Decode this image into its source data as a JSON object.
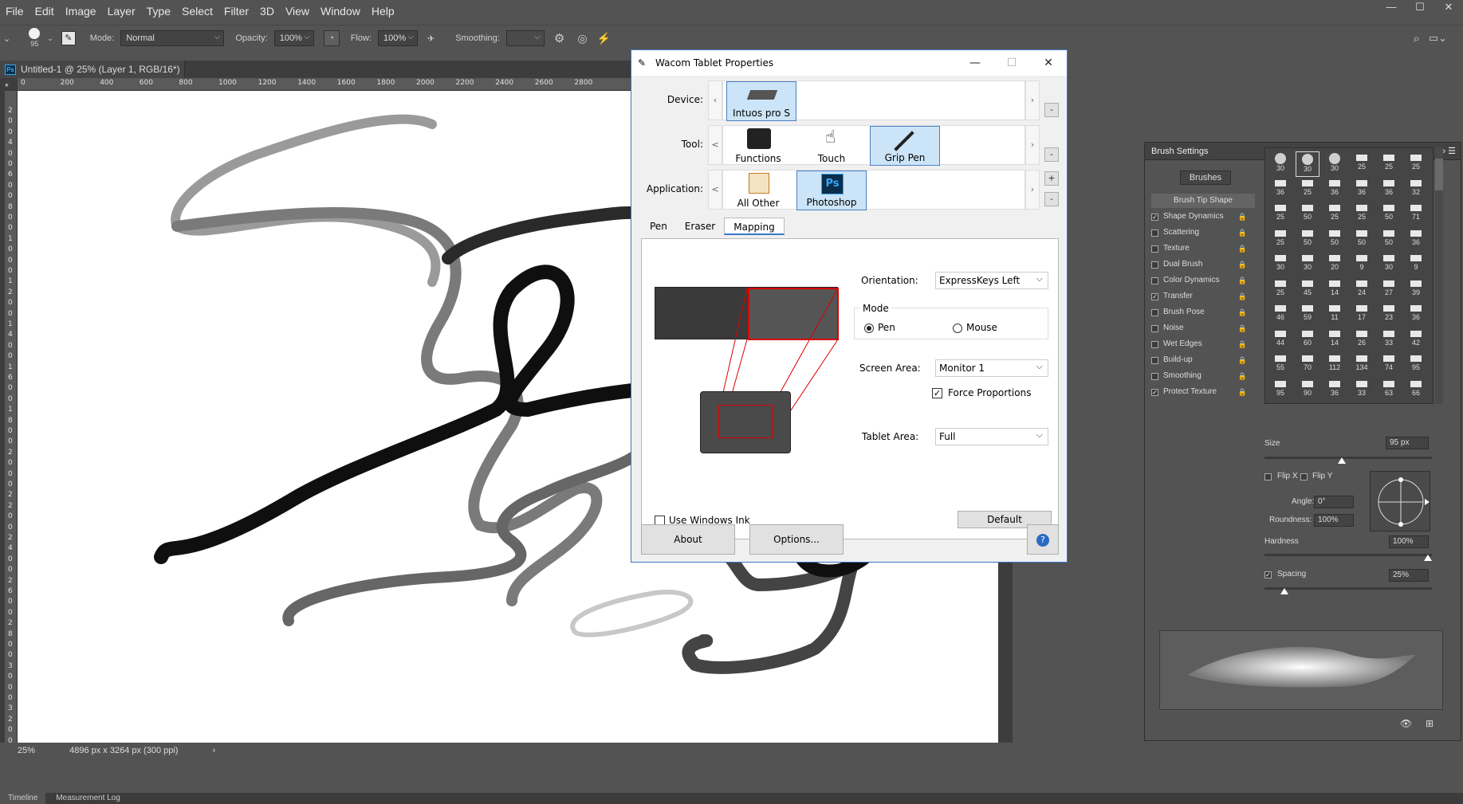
{
  "menu": [
    "File",
    "Edit",
    "Image",
    "Layer",
    "Type",
    "Select",
    "Filter",
    "3D",
    "View",
    "Window",
    "Help"
  ],
  "window_controls": [
    "—",
    "☐",
    "✕"
  ],
  "options_bar": {
    "brush_size": "95",
    "mode_label": "Mode:",
    "mode_value": "Normal",
    "opacity_label": "Opacity:",
    "opacity_value": "100%",
    "flow_label": "Flow:",
    "flow_value": "100%",
    "smoothing_label": "Smoothing:"
  },
  "document": {
    "tab_title": "Untitled-1 @ 25% (Layer 1, RGB/16*) *",
    "ruler_h": [
      "0",
      "200",
      "400",
      "600",
      "800",
      "1000",
      "1200",
      "1400",
      "1600",
      "1800",
      "2000",
      "2200",
      "2400",
      "2600",
      "2800"
    ],
    "ruler_v": [
      "2",
      "0",
      "0",
      "4",
      "0",
      "0",
      "6",
      "0",
      "0",
      "8",
      "0",
      "0",
      "1",
      "0",
      "0",
      "0",
      "1",
      "2",
      "0",
      "0",
      "1",
      "4",
      "0",
      "0",
      "1",
      "6",
      "0",
      "0",
      "1",
      "8",
      "0",
      "0",
      "2",
      "0",
      "0",
      "0",
      "2",
      "2",
      "0",
      "0",
      "2",
      "4",
      "0",
      "0",
      "2",
      "6",
      "0",
      "0",
      "2",
      "8",
      "0",
      "0",
      "3",
      "0",
      "0",
      "0",
      "3",
      "2",
      "0",
      "0"
    ],
    "zoom": "25%",
    "doc_size": "4896 px x 3264 px (300 ppi)"
  },
  "bottom_tabs": [
    "Timeline",
    "Measurement Log"
  ],
  "brush_settings": {
    "title": "Brush Settings",
    "brushes_button": "Brushes",
    "tip_shape": "Brush Tip Shape",
    "options": [
      {
        "label": "Shape Dynamics",
        "checked": true
      },
      {
        "label": "Scattering",
        "checked": false
      },
      {
        "label": "Texture",
        "checked": false
      },
      {
        "label": "Dual Brush",
        "checked": false
      },
      {
        "label": "Color Dynamics",
        "checked": false
      },
      {
        "label": "Transfer",
        "checked": true
      },
      {
        "label": "Brush Pose",
        "checked": false
      },
      {
        "label": "Noise",
        "checked": false
      },
      {
        "label": "Wet Edges",
        "checked": false
      },
      {
        "label": "Build-up",
        "checked": false
      },
      {
        "label": "Smoothing",
        "checked": false
      },
      {
        "label": "Protect Texture",
        "checked": true
      }
    ],
    "presets": [
      "30",
      "30",
      "30",
      "25",
      "25",
      "25",
      "36",
      "25",
      "36",
      "36",
      "36",
      "32",
      "25",
      "50",
      "25",
      "25",
      "50",
      "71",
      "25",
      "50",
      "50",
      "50",
      "50",
      "36",
      "30",
      "30",
      "20",
      "9",
      "30",
      "9",
      "25",
      "45",
      "14",
      "24",
      "27",
      "39",
      "46",
      "59",
      "11",
      "17",
      "23",
      "36",
      "44",
      "60",
      "14",
      "26",
      "33",
      "42",
      "55",
      "70",
      "112",
      "134",
      "74",
      "95",
      "95",
      "90",
      "36",
      "33",
      "63",
      "66"
    ],
    "size_label": "Size",
    "size_value": "95 px",
    "flip_x": "Flip X",
    "flip_y": "Flip Y",
    "angle_label": "Angle:",
    "angle_value": "0°",
    "roundness_label": "Roundness:",
    "roundness_value": "100%",
    "hardness_label": "Hardness",
    "hardness_value": "100%",
    "spacing_label": "Spacing",
    "spacing_value": "25%"
  },
  "wacom": {
    "title": "Wacom Tablet Properties",
    "device_label": "Device:",
    "device": "Intuos pro S",
    "tool_label": "Tool:",
    "tools": [
      "Functions",
      "Touch",
      "Grip Pen"
    ],
    "application_label": "Application:",
    "applications": [
      "All Other",
      "Photoshop"
    ],
    "tabs": [
      "Pen",
      "Eraser",
      "Mapping"
    ],
    "active_tab": "Mapping",
    "orientation_label": "Orientation:",
    "orientation_value": "ExpressKeys Left",
    "mode_label": "Mode",
    "mode_pen": "Pen",
    "mode_mouse": "Mouse",
    "screen_area_label": "Screen Area:",
    "screen_area_value": "Monitor 1",
    "force_proportions": "Force Proportions",
    "tablet_area_label": "Tablet Area:",
    "tablet_area_value": "Full",
    "use_windows_ink": "Use Windows Ink",
    "default_button": "Default",
    "about_button": "About",
    "options_button": "Options...",
    "help_icon": "?"
  }
}
